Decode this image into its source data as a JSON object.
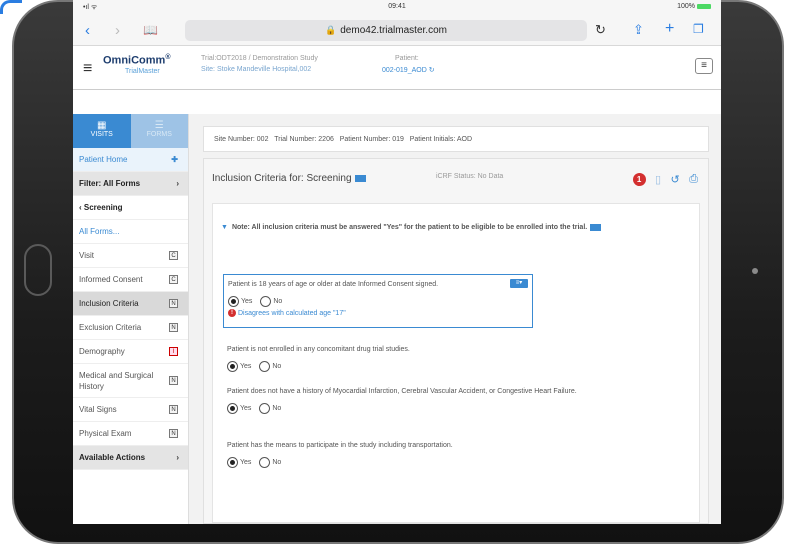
{
  "status_bar": {
    "time": "09:41",
    "battery": "100%"
  },
  "browser": {
    "url": "demo42.trialmaster.com",
    "back_icon": "chevron-left-icon",
    "forward_icon": "chevron-right-icon",
    "bookmarks_icon": "book-icon",
    "share_icon": "share-icon",
    "add_tab_icon": "plus-icon",
    "tabs_icon": "tabs-icon"
  },
  "app_header": {
    "logo": "OmniComm",
    "logo_mark": "®",
    "logo_sub": "TrialMaster",
    "study_line1": "Trial:ODT2018 / Demonstration Study",
    "study_line2": "Site: Stoke Mandeville Hospital,002",
    "patient_label": "Patient:",
    "patient_value": "002-019_AOD"
  },
  "sidebar": {
    "tab_visits": "VISITS",
    "tab_forms": "FORMS",
    "patient_home": "Patient Home",
    "filter": "Filter: All Forms",
    "screening": "Screening",
    "all_forms": "All Forms...",
    "items": [
      {
        "label": "Visit",
        "badge": "C"
      },
      {
        "label": "Informed Consent",
        "badge": "C"
      },
      {
        "label": "Inclusion Criteria",
        "badge": "N"
      },
      {
        "label": "Exclusion Criteria",
        "badge": "N"
      },
      {
        "label": "Demography",
        "badge": "I"
      },
      {
        "label": "Medical and Surgical History",
        "badge": "N"
      },
      {
        "label": "Vital Signs",
        "badge": "N"
      },
      {
        "label": "Physical Exam",
        "badge": "N"
      }
    ],
    "available_actions": "Available Actions"
  },
  "info_bar": {
    "site": "Site Number: 002",
    "trial": "Trial Number: 2206",
    "patient_number": "Patient Number: 019",
    "initials": "Patient Initials: AOD"
  },
  "form": {
    "title": "Inclusion Criteria for: Screening",
    "crf_status": "iCRF Status: No Data",
    "error_count": "1",
    "note": "Note: All inclusion criteria must be answered \"Yes\" for the patient to be eligible to be enrolled into the trial.",
    "questions": [
      {
        "text": "Patient is 18 years of age or older at date Informed Consent signed.",
        "selected": "Yes",
        "error": "Disagrees with calculated age \"17\""
      },
      {
        "text": "Patient is not enrolled in any concomitant drug trial studies.",
        "selected": "Yes"
      },
      {
        "text": "Patient does not have a history of Myocardial Infarction, Cerebral Vascular Accident, or Congestive Heart Failure.",
        "selected": "Yes"
      },
      {
        "text": "Patient has the means to participate in the study including transportation.",
        "selected": "Yes"
      }
    ],
    "option_yes": "Yes",
    "option_no": "No"
  }
}
